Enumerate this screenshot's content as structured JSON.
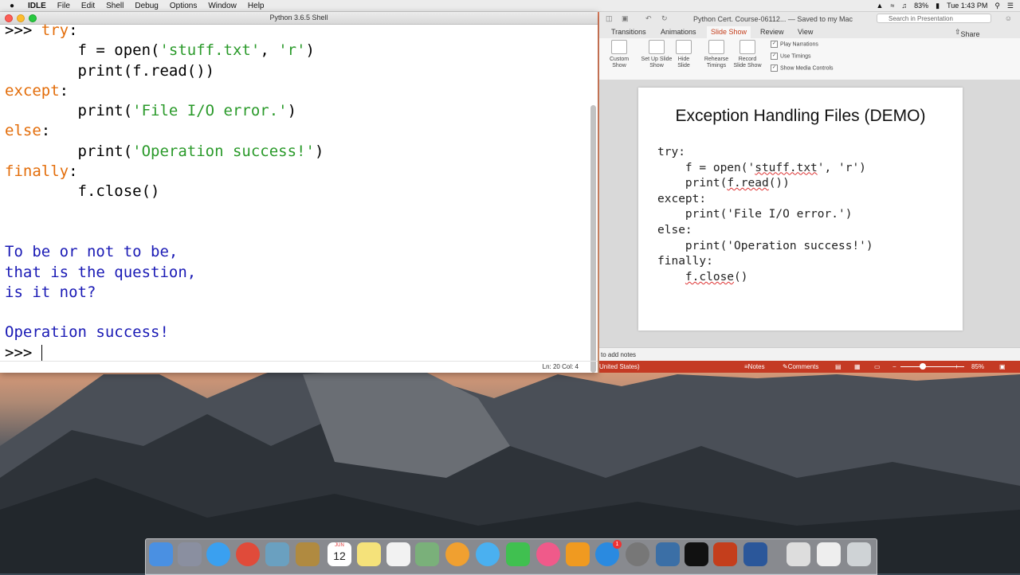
{
  "menubar": {
    "app": "IDLE",
    "items": [
      "File",
      "Edit",
      "Shell",
      "Debug",
      "Options",
      "Window",
      "Help"
    ],
    "battery": "83%",
    "clock": "Tue 1:43 PM"
  },
  "idle": {
    "title": "Python 3.6.5 Shell",
    "code": {
      "l1_prompt": ">>> ",
      "l1_kw": "try",
      "l1_tail": ":",
      "l2": "        f = open(",
      "l2_s1": "'stuff.txt'",
      "l2_mid": ", ",
      "l2_s2": "'r'",
      "l2_end": ")",
      "l3": "        print(f.read())",
      "l4_kw": "except",
      "l4_tail": ":",
      "l5_a": "        print(",
      "l5_s": "'File I/O error.'",
      "l5_b": ")",
      "l6_kw": "else",
      "l6_tail": ":",
      "l7_a": "        print(",
      "l7_s": "'Operation success!'",
      "l7_b": ")",
      "l8_kw": "finally",
      "l8_tail": ":",
      "l9": "        f.close()",
      "out1": "To be or not to be,",
      "out2": "that is the question,",
      "out3": "is it not?",
      "out4": "Operation success!",
      "prompt": ">>> "
    },
    "status": "Ln: 20   Col: 4"
  },
  "ppt": {
    "doc_title": "Python Cert. Course-06112...",
    "saved": "— Saved to my Mac",
    "search_placeholder": "Search in Presentation",
    "tabs": [
      "Transitions",
      "Animations",
      "Slide Show",
      "Review",
      "View"
    ],
    "share": "Share",
    "ribbon": {
      "custom": "Custom Show",
      "setup": "Set Up Slide Show",
      "hide": "Hide Slide",
      "rehearse": "Rehearse Timings",
      "record": "Record Slide Show",
      "chk1": "Play Narrations",
      "chk2": "Use Timings",
      "chk3": "Show Media Controls"
    },
    "slide": {
      "title": "Exception Handling Files (DEMO)",
      "l1": "try:",
      "l2a": "    f = open('",
      "l2b": "stuff.txt",
      "l2c": "', 'r')",
      "l3a": "    print(",
      "l3b": "f.read",
      "l3c": "())",
      "l4": "except:",
      "l5": "    print('File I/O error.')",
      "l6": "else:",
      "l7": "    print('Operation success!')",
      "l8": "finally:",
      "l9a": "    ",
      "l9b": "f.close",
      "l9c": "()"
    },
    "notes": "to add notes",
    "status_lang": "United States)",
    "notes_btn": "Notes",
    "comments_btn": "Comments",
    "zoom": "85%"
  },
  "dock": {
    "calendar_day": "12",
    "calendar_month": "JUN",
    "badge": "1"
  }
}
